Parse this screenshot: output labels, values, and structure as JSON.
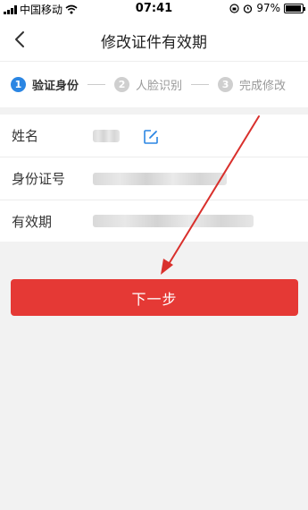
{
  "status_bar": {
    "carrier": "中国移动",
    "time": "07:41",
    "battery": "97%",
    "battery_level": 0.97
  },
  "nav": {
    "title": "修改证件有效期"
  },
  "steps": [
    {
      "num": "1",
      "label": "验证身份"
    },
    {
      "num": "2",
      "label": "人脸识别"
    },
    {
      "num": "3",
      "label": "完成修改"
    }
  ],
  "form": {
    "rows": [
      {
        "label": "姓名"
      },
      {
        "label": "身份证号"
      },
      {
        "label": "有效期"
      }
    ]
  },
  "next_button": {
    "label": "下一步"
  },
  "colors": {
    "accent_blue": "#2b86e3",
    "primary_red": "#e53935",
    "annotation_red": "#d9302c"
  }
}
